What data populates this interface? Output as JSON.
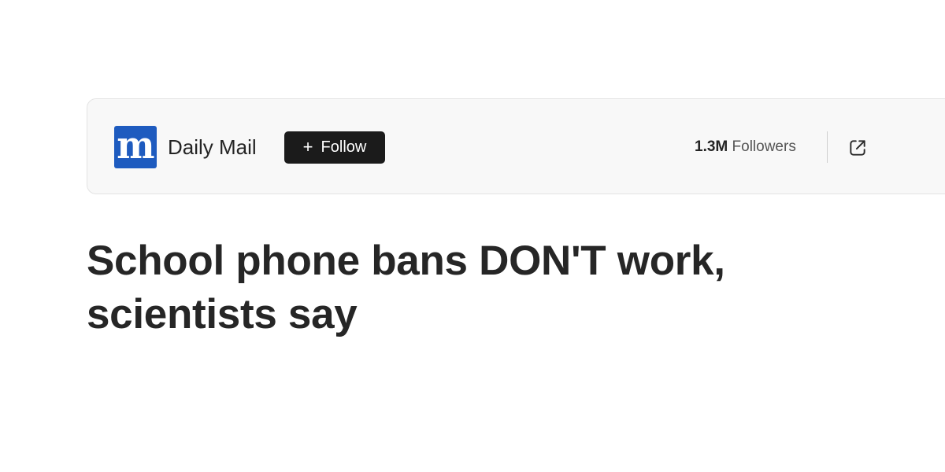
{
  "publisher": {
    "name": "Daily Mail",
    "logo_icon": "daily-mail-logo-icon",
    "logo_letter": "m",
    "logo_color": "#1e5bbf",
    "follow_label": "Follow",
    "follow_icon": "plus-icon",
    "followers_count": "1.3M",
    "followers_label": "Followers",
    "share_icon": "open-external-icon"
  },
  "article": {
    "headline": "School phone bans DON'T work, scientists say"
  }
}
